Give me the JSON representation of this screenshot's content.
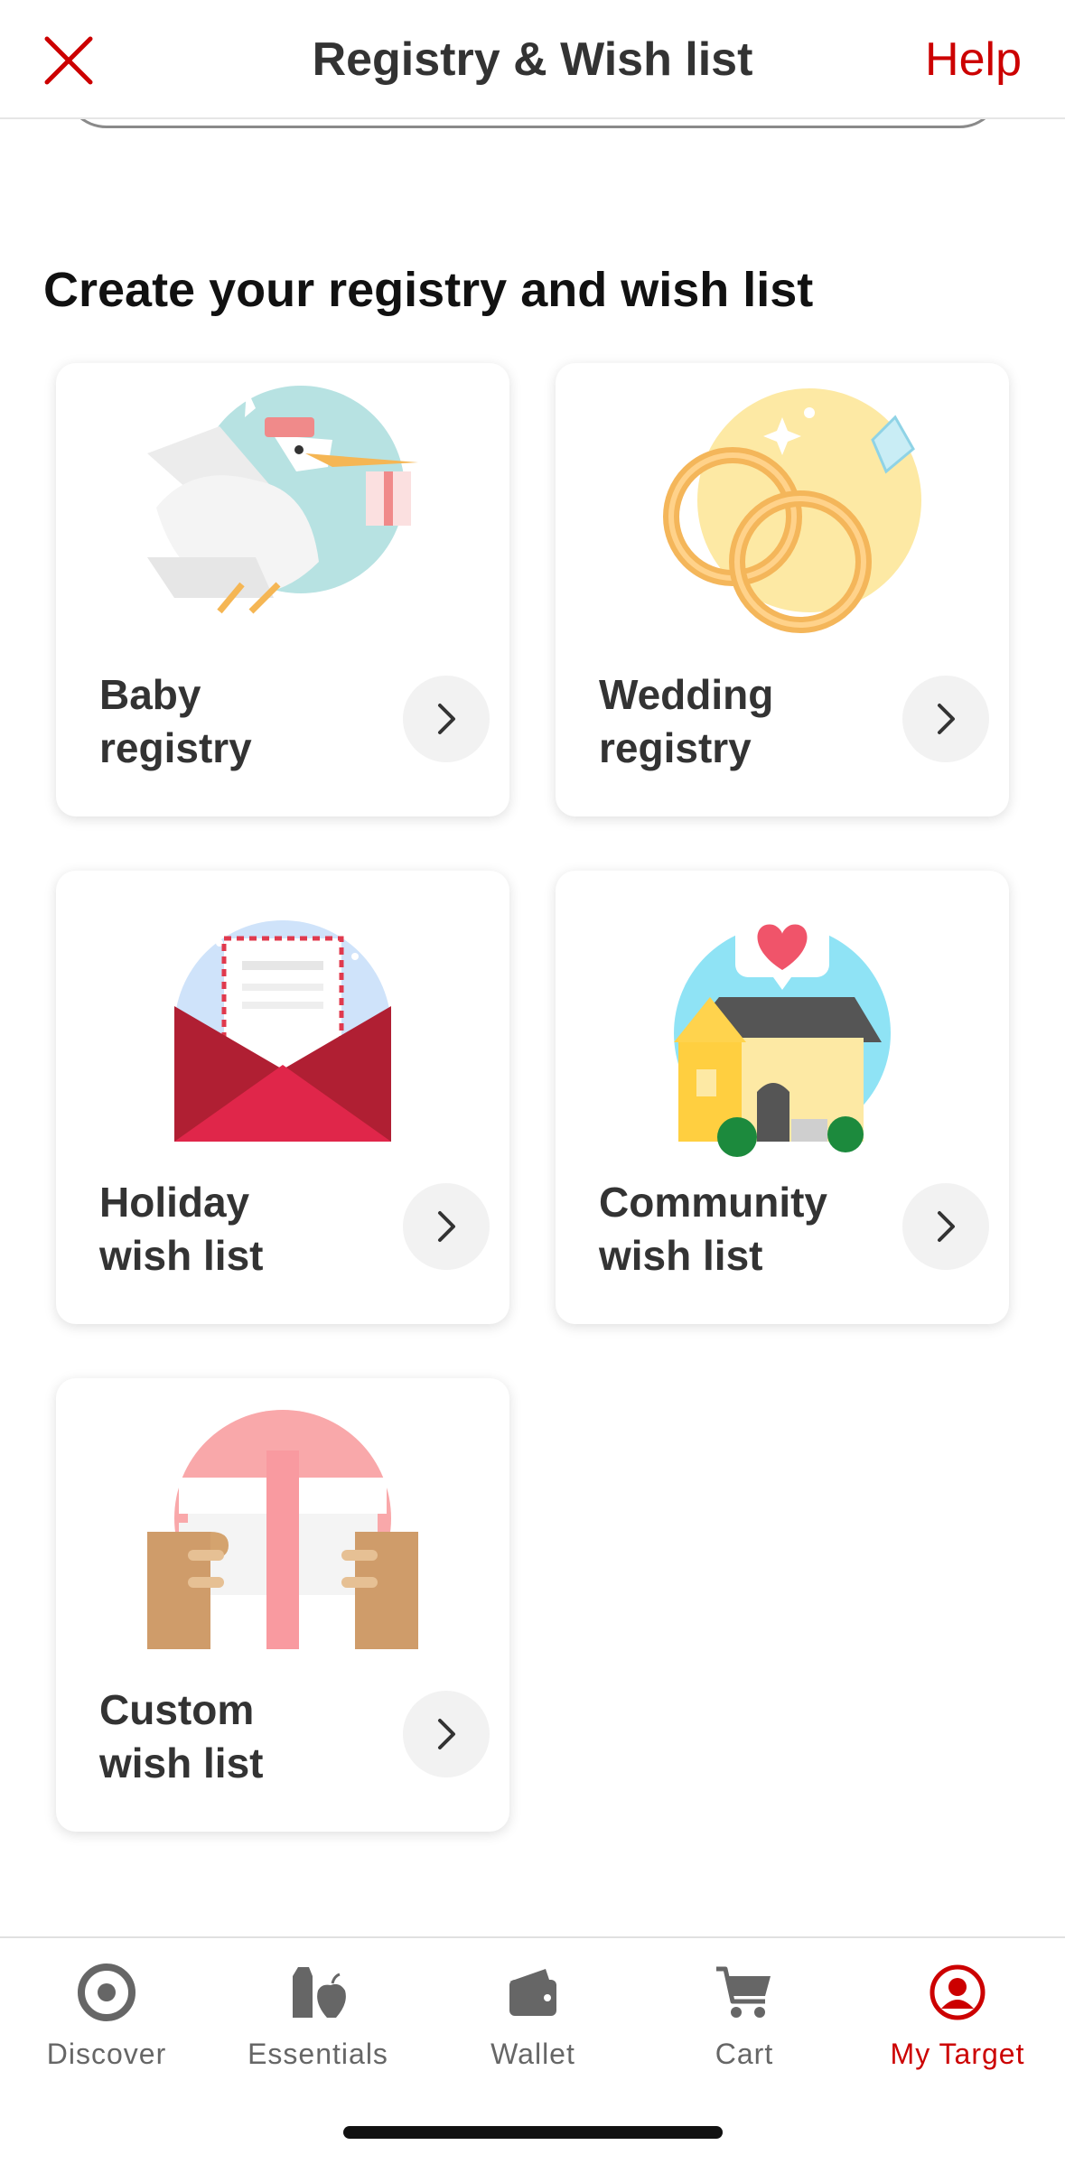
{
  "header": {
    "title": "Registry & Wish list",
    "help": "Help",
    "close_icon": "close-icon",
    "accent": "#cc0000"
  },
  "section": {
    "title": "Create your registry and wish list"
  },
  "cards": [
    {
      "line1": "Baby",
      "line2": "registry",
      "icon": "stork-illustration"
    },
    {
      "line1": "Wedding",
      "line2": "registry",
      "icon": "rings-illustration"
    },
    {
      "line1": "Holiday",
      "line2": "wish list",
      "icon": "envelope-illustration"
    },
    {
      "line1": "Community",
      "line2": "wish list",
      "icon": "house-illustration"
    },
    {
      "line1": "Custom",
      "line2": "wish list",
      "icon": "gift-illustration"
    }
  ],
  "tabbar": {
    "items": [
      {
        "label": "Discover",
        "icon": "bullseye-icon"
      },
      {
        "label": "Essentials",
        "icon": "grocery-icon"
      },
      {
        "label": "Wallet",
        "icon": "wallet-icon"
      },
      {
        "label": "Cart",
        "icon": "cart-icon"
      },
      {
        "label": "My Target",
        "icon": "account-icon"
      }
    ],
    "active": "My Target"
  }
}
